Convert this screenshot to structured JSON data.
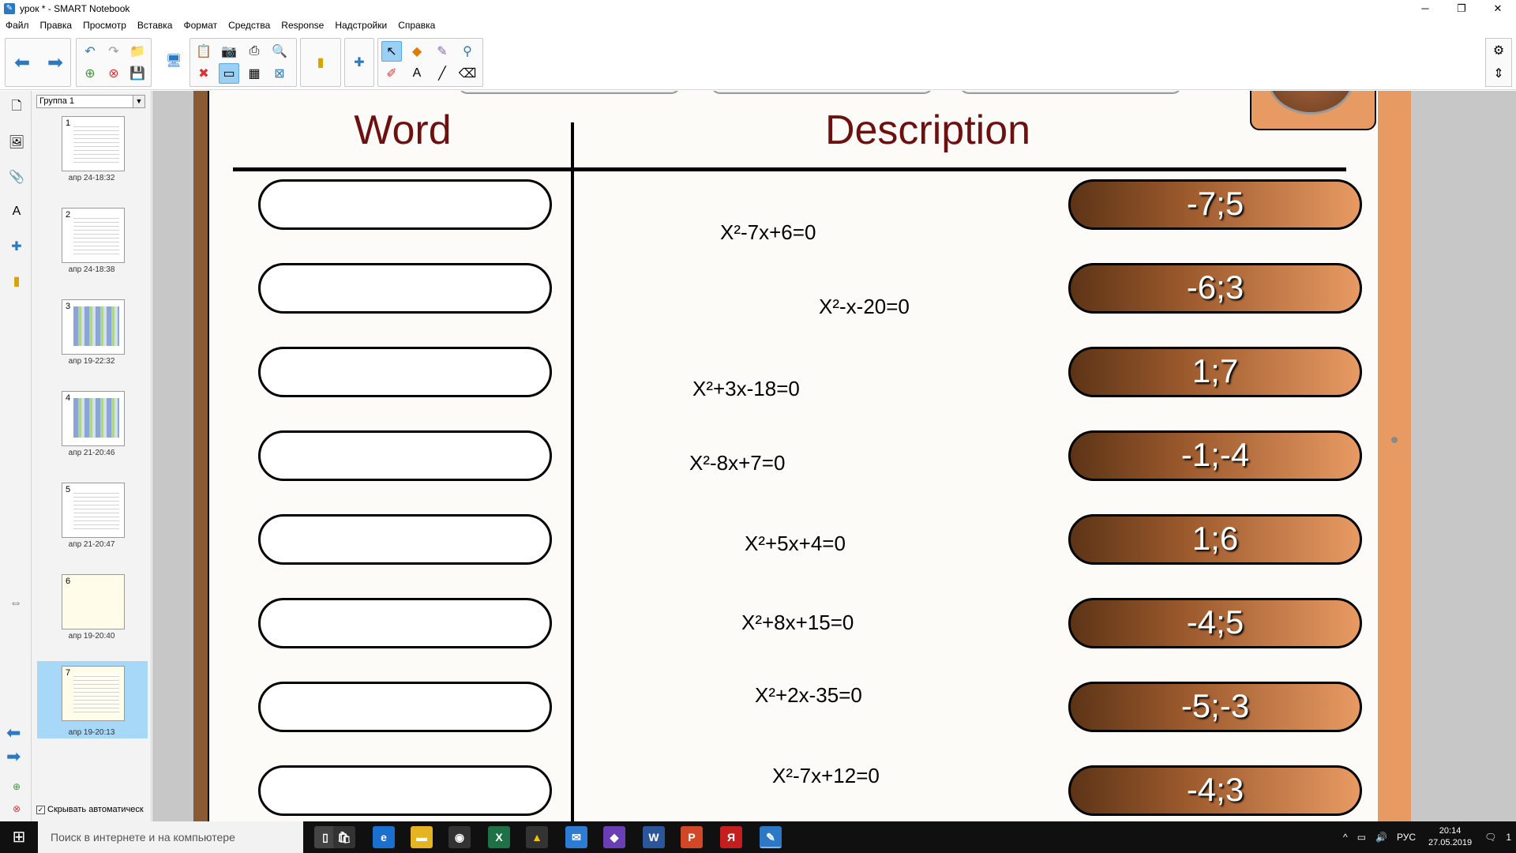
{
  "window": {
    "title": "урок * - SMART Notebook",
    "minimize": "─",
    "maximize": "❐",
    "close": "✕"
  },
  "menu": [
    "Файл",
    "Правка",
    "Просмотр",
    "Вставка",
    "Формат",
    "Средства",
    "Response",
    "Надстройки",
    "Справка"
  ],
  "sorter": {
    "group": "Группа 1",
    "autohide_label": "Скрывать автоматическ",
    "pages": [
      {
        "num": "1",
        "date": "апр 24-18:32"
      },
      {
        "num": "2",
        "date": "апр 24-18:38"
      },
      {
        "num": "3",
        "date": "апр 19-22:32"
      },
      {
        "num": "4",
        "date": "апр 21-20:46"
      },
      {
        "num": "5",
        "date": "апр 21-20:47"
      },
      {
        "num": "6",
        "date": "апр 19-20:40"
      },
      {
        "num": "7",
        "date": "апр 19-20:13"
      }
    ]
  },
  "canvas": {
    "header_word": "Word",
    "header_description": "Description",
    "equations": [
      "X²-7x+6=0",
      "X²-x-20=0",
      "X²+3x-18=0",
      "X²-8x+7=0",
      "X²+5x+4=0",
      "X²+8x+15=0",
      "X²+2x-35=0",
      "X²-7x+12=0"
    ],
    "answers": [
      "-7;5",
      "-6;3",
      "1;7",
      "-1;-4",
      "1;6",
      "-4;5",
      "-5;-3",
      "-4;3"
    ]
  },
  "taskbar": {
    "search_placeholder": "Поиск в интернете и на компьютере",
    "lang": "РУС",
    "time": "20:14",
    "date": "27.05.2019",
    "notifications": "1"
  },
  "colors": {
    "header_text": "#6e1010",
    "frame_brown": "#8a5a33",
    "answer_gradient_dark": "#5c3416",
    "answer_gradient_light": "#e89a63"
  }
}
